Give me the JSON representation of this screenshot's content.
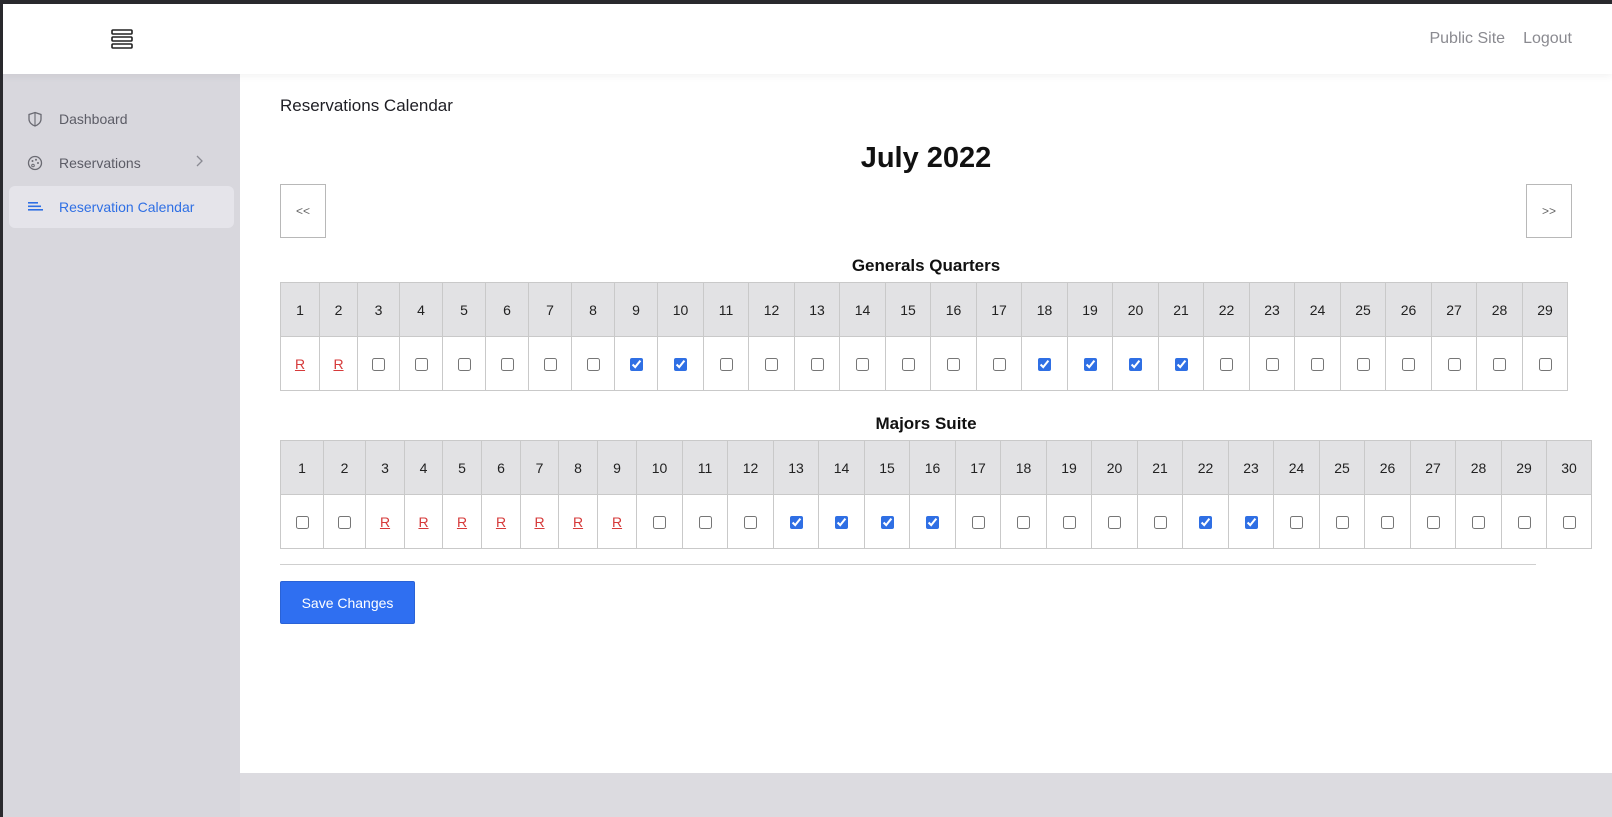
{
  "header": {
    "public_site": "Public Site",
    "logout": "Logout"
  },
  "sidebar": {
    "items": [
      {
        "label": "Dashboard",
        "icon": "shield-icon"
      },
      {
        "label": "Reservations",
        "icon": "palette-icon"
      },
      {
        "label": "Reservation Calendar",
        "icon": "lines-icon",
        "active": true
      }
    ]
  },
  "main": {
    "title": "Reservations Calendar",
    "month": "July 2022",
    "prev_label": "<<",
    "next_label": ">>",
    "save_label": "Save Changes"
  },
  "colors": {
    "accent": "#2f6fe4",
    "reserved": "#d63a3a",
    "header_cell": "#e2e2e4"
  },
  "rooms": [
    {
      "name": "Generals Quarters",
      "days": [
        {
          "day": "1",
          "state": "R"
        },
        {
          "day": "2",
          "state": "R"
        },
        {
          "day": "3",
          "state": "empty"
        },
        {
          "day": "4",
          "state": "empty"
        },
        {
          "day": "5",
          "state": "empty"
        },
        {
          "day": "6",
          "state": "empty"
        },
        {
          "day": "7",
          "state": "empty"
        },
        {
          "day": "8",
          "state": "empty"
        },
        {
          "day": "9",
          "state": "checked"
        },
        {
          "day": "10",
          "state": "checked"
        },
        {
          "day": "11",
          "state": "empty"
        },
        {
          "day": "12",
          "state": "empty"
        },
        {
          "day": "13",
          "state": "empty"
        },
        {
          "day": "14",
          "state": "empty"
        },
        {
          "day": "15",
          "state": "empty"
        },
        {
          "day": "16",
          "state": "empty"
        },
        {
          "day": "17",
          "state": "empty"
        },
        {
          "day": "18",
          "state": "checked"
        },
        {
          "day": "19",
          "state": "checked"
        },
        {
          "day": "20",
          "state": "checked"
        },
        {
          "day": "21",
          "state": "checked"
        },
        {
          "day": "22",
          "state": "empty"
        },
        {
          "day": "23",
          "state": "empty"
        },
        {
          "day": "24",
          "state": "empty"
        },
        {
          "day": "25",
          "state": "empty"
        },
        {
          "day": "26",
          "state": "empty"
        },
        {
          "day": "27",
          "state": "empty"
        },
        {
          "day": "28",
          "state": "empty"
        },
        {
          "day": "29",
          "state": "empty"
        }
      ]
    },
    {
      "name": "Majors Suite",
      "days": [
        {
          "day": "1",
          "state": "empty"
        },
        {
          "day": "2",
          "state": "empty"
        },
        {
          "day": "3",
          "state": "R"
        },
        {
          "day": "4",
          "state": "R"
        },
        {
          "day": "5",
          "state": "R"
        },
        {
          "day": "6",
          "state": "R"
        },
        {
          "day": "7",
          "state": "R"
        },
        {
          "day": "8",
          "state": "R"
        },
        {
          "day": "9",
          "state": "R"
        },
        {
          "day": "10",
          "state": "empty"
        },
        {
          "day": "11",
          "state": "empty"
        },
        {
          "day": "12",
          "state": "empty"
        },
        {
          "day": "13",
          "state": "checked"
        },
        {
          "day": "14",
          "state": "checked"
        },
        {
          "day": "15",
          "state": "checked"
        },
        {
          "day": "16",
          "state": "checked"
        },
        {
          "day": "17",
          "state": "empty"
        },
        {
          "day": "18",
          "state": "empty"
        },
        {
          "day": "19",
          "state": "empty"
        },
        {
          "day": "20",
          "state": "empty"
        },
        {
          "day": "21",
          "state": "empty"
        },
        {
          "day": "22",
          "state": "checked"
        },
        {
          "day": "23",
          "state": "checked"
        },
        {
          "day": "24",
          "state": "empty"
        },
        {
          "day": "25",
          "state": "empty"
        },
        {
          "day": "26",
          "state": "empty"
        },
        {
          "day": "27",
          "state": "empty"
        },
        {
          "day": "28",
          "state": "empty"
        },
        {
          "day": "29",
          "state": "empty"
        },
        {
          "day": "30",
          "state": "empty"
        }
      ]
    }
  ]
}
